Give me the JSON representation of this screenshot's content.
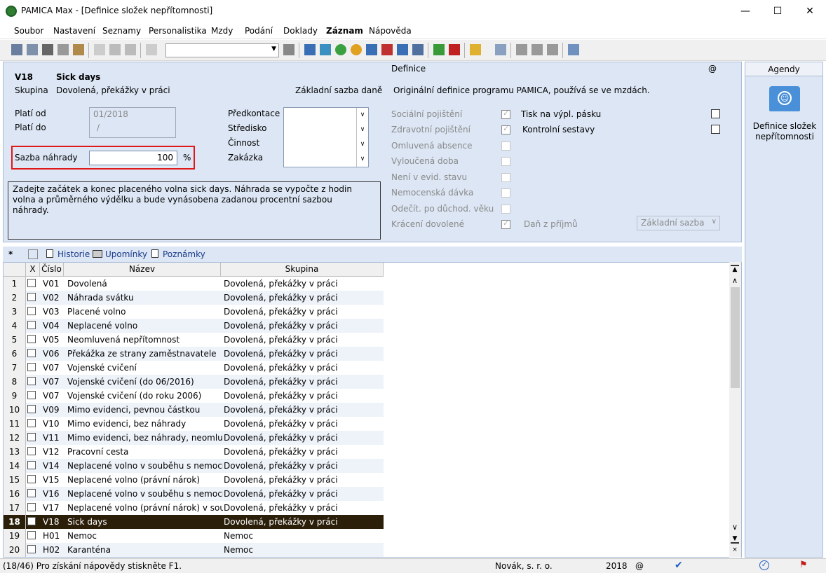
{
  "window": {
    "title": "PAMICA Max - [Definice složek nepřítomnosti]",
    "minimize": "—",
    "maximize": "☐",
    "close": "✕"
  },
  "menu": [
    "Soubor",
    "Nastavení",
    "Seznamy",
    "Personalistika",
    "Mzdy",
    "Podání",
    "Doklady",
    "Záznam",
    "Nápověda"
  ],
  "record": {
    "code": "V18",
    "name": "Sick days",
    "group_label": "Skupina",
    "group_value": "Dovolená, překážky v práci",
    "base_tax": "Základní sazba daně",
    "valid_from_label": "Platí od",
    "valid_from_value": "01/2018",
    "valid_to_label": "Platí do",
    "valid_to_value": "/",
    "rate_label": "Sazba náhrady",
    "rate_value": "100",
    "rate_unit": "%",
    "predkontace": "Předkontace",
    "stredisko": "Středisko",
    "cinnost": "Činnost",
    "zakazka": "Zakázka",
    "description": "Zadejte začátek a konec placeného volna sick days. Náhrada se vypočte z hodin volna a průměrného výdělku a bude vynásobena zadanou procentní sazbou náhrady."
  },
  "definition": {
    "label": "Definice",
    "at": "@",
    "text": "Originální definice programu PAMICA, používá se ve mzdách.",
    "flags": [
      {
        "label": "Sociální pojištění",
        "checked": true
      },
      {
        "label": "Zdravotní pojištění",
        "checked": true
      },
      {
        "label": "Omluvená absence",
        "checked": false
      },
      {
        "label": "Vyloučená doba",
        "checked": false
      },
      {
        "label": "Není v evid. stavu",
        "checked": false
      },
      {
        "label": "Nemocenská dávka",
        "checked": false
      },
      {
        "label": "Odečít. po důchod. věku",
        "checked": false
      },
      {
        "label": "Krácení dovolené",
        "checked": true
      }
    ],
    "tisk": "Tisk na výpl. pásku",
    "kontrolni": "Kontrolní sestavy",
    "dan_label": "Daň z příjmů",
    "dan_value": "Základní sazba"
  },
  "agenda": {
    "header": "Agendy",
    "item": "Definice složek nepřítomnosti"
  },
  "tabs": {
    "star": "*",
    "historie": "Historie",
    "upominky": "Upomínky",
    "poznamky": "Poznámky"
  },
  "grid": {
    "headers": {
      "x": "X",
      "cislo": "Číslo",
      "nazev": "Název",
      "skupina": "Skupina"
    },
    "rows": [
      {
        "n": "1",
        "c": "V01",
        "name": "Dovolená",
        "g": "Dovolená, překážky v práci"
      },
      {
        "n": "2",
        "c": "V02",
        "name": "Náhrada svátku",
        "g": "Dovolená, překážky v práci"
      },
      {
        "n": "3",
        "c": "V03",
        "name": "Placené volno",
        "g": "Dovolená, překážky v práci"
      },
      {
        "n": "4",
        "c": "V04",
        "name": "Neplacené volno",
        "g": "Dovolená, překážky v práci"
      },
      {
        "n": "5",
        "c": "V05",
        "name": "Neomluvená nepřítomnost",
        "g": "Dovolená, překážky v práci"
      },
      {
        "n": "6",
        "c": "V06",
        "name": "Překážka ze strany zaměstnavatele",
        "g": "Dovolená, překážky v práci"
      },
      {
        "n": "7",
        "c": "V07",
        "name": "Vojenské cvičení",
        "g": "Dovolená, překážky v práci"
      },
      {
        "n": "8",
        "c": "V07",
        "name": "Vojenské cvičení (do 06/2016)",
        "g": "Dovolená, překážky v práci"
      },
      {
        "n": "9",
        "c": "V07",
        "name": "Vojenské cvičení (do roku 2006)",
        "g": "Dovolená, překážky v práci"
      },
      {
        "n": "10",
        "c": "V09",
        "name": "Mimo evidenci, pevnou částkou",
        "g": "Dovolená, překážky v práci"
      },
      {
        "n": "11",
        "c": "V10",
        "name": "Mimo evidenci, bez náhrady",
        "g": "Dovolená, překážky v práci"
      },
      {
        "n": "12",
        "c": "V11",
        "name": "Mimo evidenci, bez náhrady, neomluve …",
        "g": "Dovolená, překážky v práci"
      },
      {
        "n": "13",
        "c": "V12",
        "name": "Pracovní cesta",
        "g": "Dovolená, překážky v práci"
      },
      {
        "n": "14",
        "c": "V14",
        "name": "Neplacené volno v souběhu s nemocí",
        "g": "Dovolená, překážky v práci"
      },
      {
        "n": "15",
        "c": "V15",
        "name": "Neplacené volno (právní nárok)",
        "g": "Dovolená, překážky v práci"
      },
      {
        "n": "16",
        "c": "V16",
        "name": "Neplacené volno v souběhu s nemocí",
        "g": "Dovolená, překážky v práci"
      },
      {
        "n": "17",
        "c": "V17",
        "name": "Neplacené volno (právní nárok) v soubě …",
        "g": "Dovolená, překážky v práci"
      },
      {
        "n": "18",
        "c": "V18",
        "name": "Sick days",
        "g": "Dovolená, překážky v práci",
        "selected": true
      },
      {
        "n": "19",
        "c": "H01",
        "name": "Nemoc",
        "g": "Nemoc"
      },
      {
        "n": "20",
        "c": "H02",
        "name": "Karanténa",
        "g": "Nemoc"
      }
    ]
  },
  "status": {
    "help": "(18/46) Pro získání nápovědy stiskněte F1.",
    "company": "Novák, s. r. o.",
    "year": "2018",
    "at": "@"
  }
}
